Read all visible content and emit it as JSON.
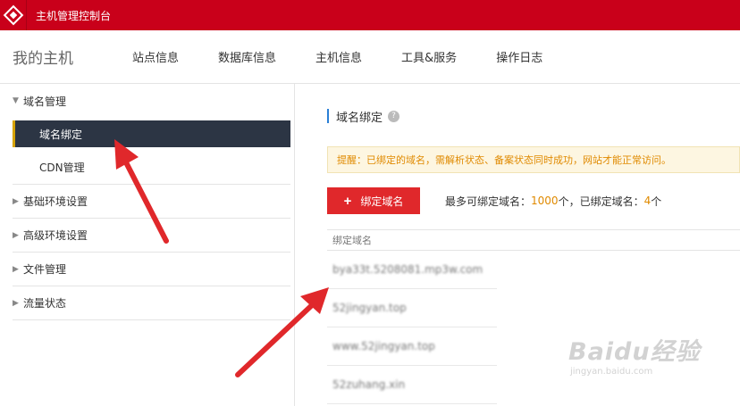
{
  "topbar": {
    "title": "主机管理控制台"
  },
  "nav": {
    "brand": "我的主机",
    "tabs": [
      "站点信息",
      "数据库信息",
      "主机信息",
      "工具&服务",
      "操作日志"
    ]
  },
  "sidebar": {
    "domain_group": "域名管理",
    "domain_bind": "域名绑定",
    "cdn": "CDN管理",
    "basic_env": "基础环境设置",
    "advanced_env": "高级环境设置",
    "file_mgmt": "文件管理",
    "traffic": "流量状态"
  },
  "main": {
    "section_title": "域名绑定",
    "help": "?",
    "notice": "提醒：已绑定的域名，需解析状态、备案状态同时成功，网站才能正常访问。",
    "bind_button": "绑定域名",
    "quota_prefix": "最多可绑定域名：",
    "quota_max": "1000",
    "quota_mid": "个，已绑定域名：",
    "quota_bound": "4",
    "quota_suffix": "个",
    "table_header": "绑定域名",
    "domains": [
      "bya33t.5208081.mp3w.com",
      "52jingyan.top",
      "www.52jingyan.top",
      "52zuhang.xin"
    ]
  },
  "watermark": {
    "big": "Baidu经验",
    "small": "jingyan.baidu.com"
  },
  "colors": {
    "topbar": "#c9001a",
    "active_item": "#2c3544",
    "button": "#e0282b",
    "notice_text": "#e08a00",
    "arrow": "#e0282b"
  }
}
